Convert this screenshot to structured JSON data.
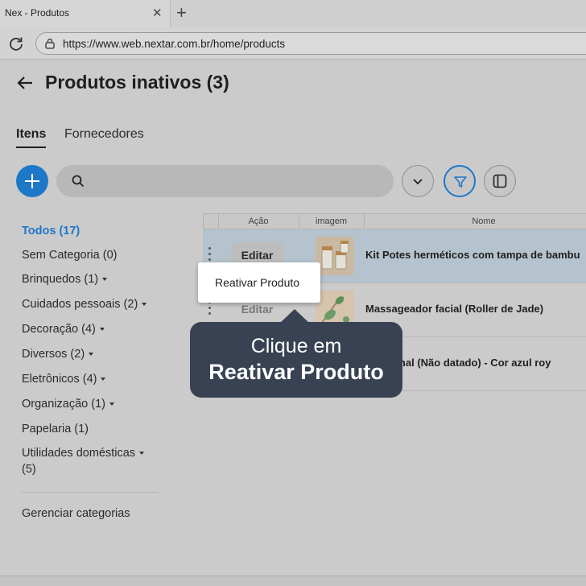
{
  "browser": {
    "tab_title": "Nex - Produtos",
    "url": "https://www.web.nextar.com.br/home/products"
  },
  "header": {
    "title": "Produtos inativos",
    "count": "(3)"
  },
  "tabs": {
    "itens": "Itens",
    "fornecedores": "Fornecedores"
  },
  "search": {
    "placeholder": ""
  },
  "sidebar": {
    "categories": [
      {
        "label": "Todos (17)"
      },
      {
        "label": "Sem Categoria (0)"
      },
      {
        "label": "Brinquedos (1)"
      },
      {
        "label": "Cuidados pessoais (2)"
      },
      {
        "label": "Decoração (4)"
      },
      {
        "label": "Diversos (2)"
      },
      {
        "label": "Eletrônicos (4)"
      },
      {
        "label": "Organização (1)"
      },
      {
        "label": "Papelaria (1)"
      },
      {
        "label": "Utilidades domésticas"
      },
      {
        "label": "(5)"
      }
    ],
    "manage": "Gerenciar categorias"
  },
  "table": {
    "headers": {
      "acao": "Ação",
      "imagem": "imagem",
      "nome": "Nome"
    },
    "rows": [
      {
        "edit": "Editar",
        "name": "Kit Potes herméticos com tampa de bambu"
      },
      {
        "edit": "Editar",
        "name": "Massageador facial (Roller de Jade)"
      },
      {
        "name": "r semanal (Não datado) - Cor azul roy"
      }
    ]
  },
  "popup": {
    "label": "Reativar Produto"
  },
  "tooltip": {
    "line1": "Clique em",
    "line2": "Reativar Produto"
  },
  "colors": {
    "accent": "#1e78c8",
    "tooltip_bg": "#384252",
    "row_highlight": "#b4c3ce"
  }
}
